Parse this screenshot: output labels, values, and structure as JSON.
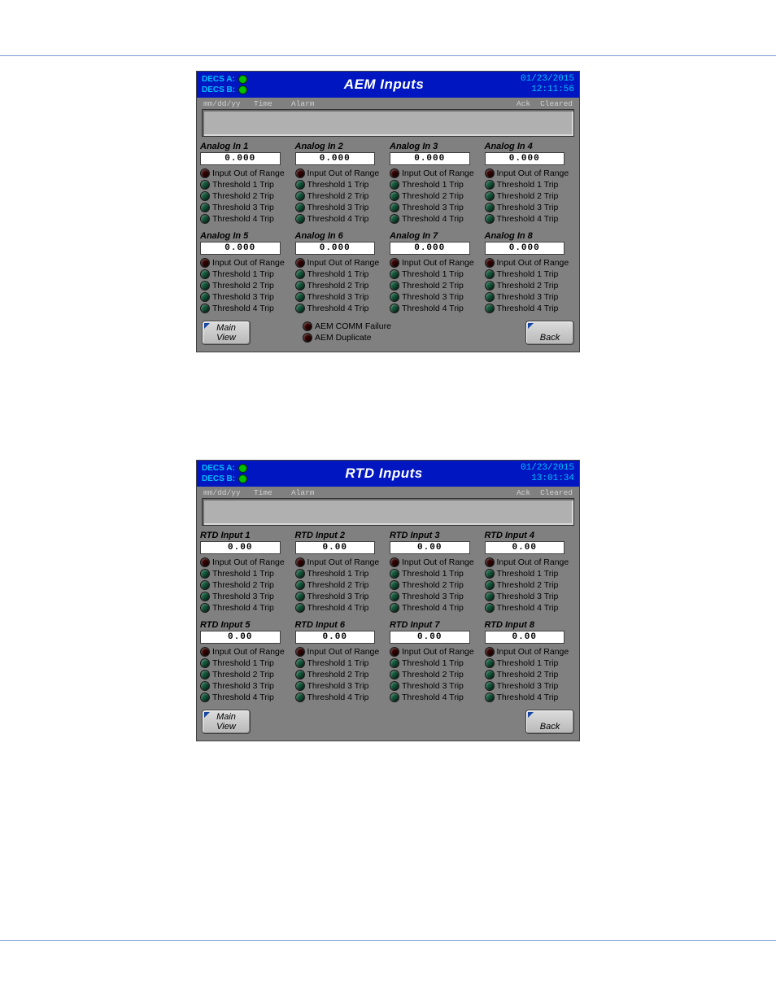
{
  "panels": [
    {
      "title": "AEM Inputs",
      "decs": [
        {
          "label": "DECS A:",
          "led": "hled"
        },
        {
          "label": "DECS B:",
          "led": "hled"
        }
      ],
      "date": "01/23/2015",
      "time": "12:11:56",
      "alarm_headers": {
        "c1": "mm/dd/yy",
        "c2": "Time",
        "c3": "Alarm",
        "c4": "Ack",
        "c5": "Cleared"
      },
      "channel_prefix": "Analog In",
      "value_format": "0.000",
      "status_rows": [
        {
          "label": "Input Out of Range",
          "cls": "off"
        },
        {
          "label": "Threshold 1 Trip",
          "cls": "on"
        },
        {
          "label": "Threshold 2 Trip",
          "cls": "on"
        },
        {
          "label": "Threshold 3 Trip",
          "cls": "on"
        },
        {
          "label": "Threshold 4 Trip",
          "cls": "on"
        }
      ],
      "channels_top": [
        {
          "n": "1",
          "v": "0.000"
        },
        {
          "n": "2",
          "v": "0.000"
        },
        {
          "n": "3",
          "v": "0.000"
        },
        {
          "n": "4",
          "v": "0.000"
        }
      ],
      "channels_bot": [
        {
          "n": "5",
          "v": "0.000"
        },
        {
          "n": "6",
          "v": "0.000"
        },
        {
          "n": "7",
          "v": "0.000"
        },
        {
          "n": "8",
          "v": "0.000"
        }
      ],
      "footer_mid": [
        {
          "label": "AEM COMM Failure",
          "cls": "off"
        },
        {
          "label": "AEM Duplicate",
          "cls": "off"
        }
      ],
      "btn_main_l1": "Main",
      "btn_main_l2": "View",
      "btn_back": "Back"
    },
    {
      "title": "RTD Inputs",
      "decs": [
        {
          "label": "DECS A:",
          "led": "hled"
        },
        {
          "label": "DECS B:",
          "led": "hled"
        }
      ],
      "date": "01/23/2015",
      "time": "13:01:34",
      "alarm_headers": {
        "c1": "mm/dd/yy",
        "c2": "Time",
        "c3": "Alarm",
        "c4": "Ack",
        "c5": "Cleared"
      },
      "channel_prefix": "RTD Input",
      "value_format": "0.00",
      "status_rows": [
        {
          "label": "Input Out of Range",
          "cls": "off"
        },
        {
          "label": "Threshold 1 Trip",
          "cls": "on"
        },
        {
          "label": "Threshold 2 Trip",
          "cls": "on"
        },
        {
          "label": "Threshold 3 Trip",
          "cls": "on"
        },
        {
          "label": "Threshold 4 Trip",
          "cls": "on"
        }
      ],
      "channels_top": [
        {
          "n": "1",
          "v": "0.00"
        },
        {
          "n": "2",
          "v": "0.00"
        },
        {
          "n": "3",
          "v": "0.00"
        },
        {
          "n": "4",
          "v": "0.00"
        }
      ],
      "channels_bot": [
        {
          "n": "5",
          "v": "0.00"
        },
        {
          "n": "6",
          "v": "0.00"
        },
        {
          "n": "7",
          "v": "0.00"
        },
        {
          "n": "8",
          "v": "0.00"
        }
      ],
      "footer_mid": [],
      "btn_main_l1": "Main",
      "btn_main_l2": "View",
      "btn_back": "Back"
    }
  ]
}
